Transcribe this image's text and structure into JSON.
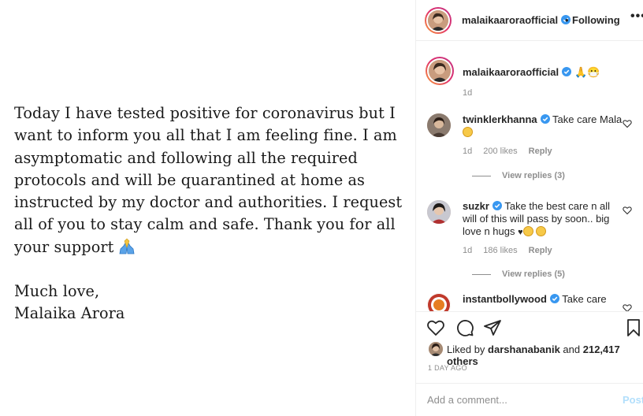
{
  "post": {
    "paragraph1": "Today I have tested positive for coronavirus but I want to inform you all that I am feeling fine. I am asymptomatic and following all the required protocols and will be quarantined at home as instructed by my doctor and authorities. I request all of you to stay calm and safe. Thank you for all your support",
    "signoff_line1": "Much love,",
    "signoff_line2": "Malaika Arora"
  },
  "header": {
    "username": "malaikaaroraofficial",
    "separator": "•",
    "follow_status": "Following",
    "more": "•••"
  },
  "caption": {
    "username": "malaikaaroraofficial",
    "emojis": "🙏😷",
    "time": "1d"
  },
  "comments": [
    {
      "username": "twinklerkhanna",
      "text": "Take care Mala",
      "time": "1d",
      "likes": "200 likes",
      "reply": "Reply",
      "view_replies": "View replies (3)"
    },
    {
      "username": "suzkr",
      "text": "Take the best care n all will of this will pass by soon.. big love n hugs",
      "time": "1d",
      "likes": "186 likes",
      "reply": "Reply",
      "view_replies": "View replies (5)"
    },
    {
      "username": "instantbollywood",
      "text": "Take care"
    }
  ],
  "likes": {
    "prefix": "Liked by ",
    "user": "darshanabanik",
    "middle": " and ",
    "count": "212,417 others"
  },
  "timestamp": "1 DAY AGO",
  "add_comment": {
    "placeholder": "Add a comment...",
    "post_label": "Post"
  },
  "colors": {
    "verified": "#3897f0",
    "post_button": "#b2dffc",
    "muted_text": "#8e8e8e"
  }
}
